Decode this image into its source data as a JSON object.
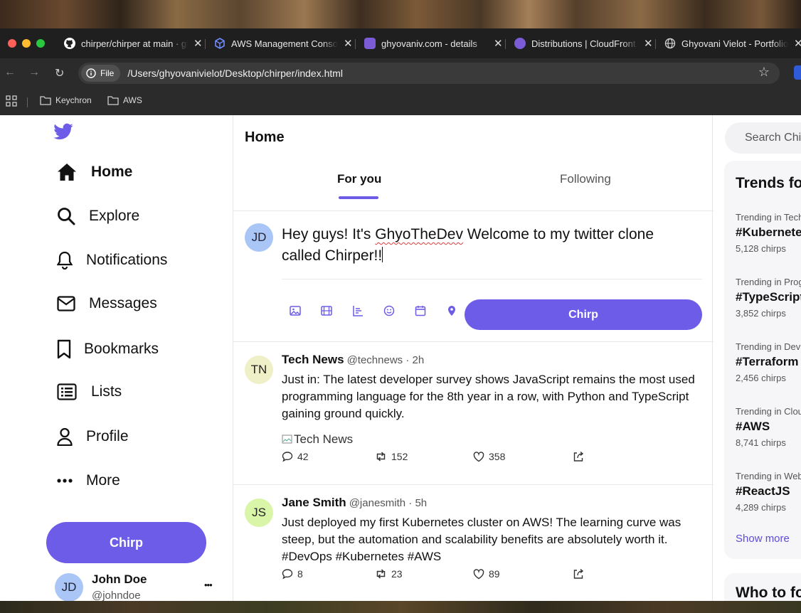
{
  "browser": {
    "tabs": [
      {
        "title": "chirper/chirper at main · ghyovanivielot/chirper",
        "icon": "github-icon"
      },
      {
        "title": "AWS Management Console",
        "icon": "aws-cube-icon"
      },
      {
        "title": "ghyovaniv.com - details",
        "icon": "domain-icon"
      },
      {
        "title": "Distributions | CloudFront",
        "icon": "cloudfront-icon"
      },
      {
        "title": "Ghyovani Vielot - Portfolio",
        "icon": "globe-icon"
      }
    ],
    "address": {
      "scheme_label": "File",
      "url": "/Users/ghyovanivielot/Desktop/chirper/index.html"
    },
    "bookmarks": [
      "Keychron",
      "AWS"
    ]
  },
  "sidebar": {
    "nav": [
      "Home",
      "Explore",
      "Notifications",
      "Messages",
      "Bookmarks",
      "Lists",
      "Profile",
      "More"
    ],
    "chirp_label": "Chirp",
    "user": {
      "initials": "JD",
      "name": "John Doe",
      "handle": "@johndoe",
      "menu": "•••"
    }
  },
  "main": {
    "title": "Home",
    "tabs": [
      "For you",
      "Following"
    ],
    "compose": {
      "avatar": "JD",
      "text_before": "Hey guys! It's ",
      "text_flagged": "GhyoTheDev",
      "text_after": " Welcome to my twitter clone called Chirper!!",
      "button": "Chirp"
    },
    "posts": [
      {
        "initials": "TN",
        "name": "Tech News",
        "handle": "@technews · 2h",
        "text": "Just in: The latest developer survey shows JavaScript remains the most used programming language for the 8th year in a row, with Python and TypeScript gaining ground quickly.",
        "image_alt": "Tech News",
        "replies": "42",
        "rechirps": "152",
        "likes": "358"
      },
      {
        "initials": "JS",
        "name": "Jane Smith",
        "handle": "@janesmith · 5h",
        "text": "Just deployed my first Kubernetes cluster on AWS! The learning curve was steep, but the automation and scalability benefits are absolutely worth it. #DevOps #Kubernetes #AWS",
        "replies": "8",
        "rechirps": "23",
        "likes": "89"
      }
    ]
  },
  "right": {
    "search_placeholder": "Search Chirper",
    "trends_title": "Trends for you",
    "trends": [
      {
        "context": "Trending in Technology",
        "tag": "#Kubernetes",
        "count": "5,128 chirps"
      },
      {
        "context": "Trending in Programming",
        "tag": "#TypeScript",
        "count": "3,852 chirps"
      },
      {
        "context": "Trending in DevOps",
        "tag": "#Terraform",
        "count": "2,456 chirps"
      },
      {
        "context": "Trending in Cloud",
        "tag": "#AWS",
        "count": "8,741 chirps"
      },
      {
        "context": "Trending in Web",
        "tag": "#ReactJS",
        "count": "4,289 chirps"
      }
    ],
    "show_more": "Show more",
    "who_to_follow": "Who to follow"
  },
  "colors": {
    "accent": "#6c5ce7",
    "avatar_jd": "#a9c6f7",
    "avatar_tn": "#f0f0c8",
    "avatar_js": "#d9f5a8"
  }
}
